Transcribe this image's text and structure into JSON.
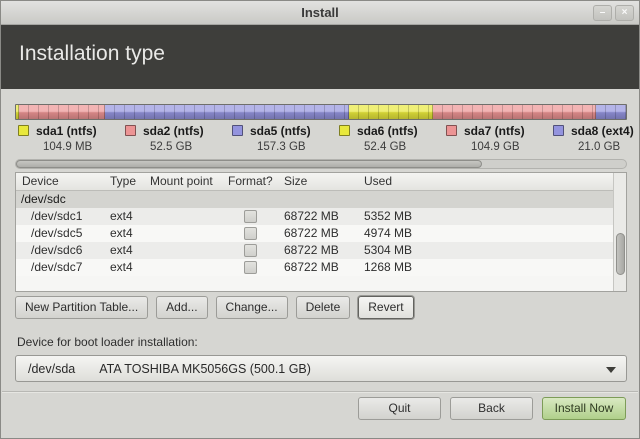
{
  "titlebar": {
    "title": "Install",
    "minimize_glyph": "–",
    "close_glyph": "×"
  },
  "header": {
    "title": "Installation type"
  },
  "partitions": [
    {
      "label": "sda1 (ntfs)",
      "size": "104.9 MB",
      "chip_color": "#e8e83c",
      "bar_flex": 0.25
    },
    {
      "label": "sda2 (ntfs)",
      "size": "52.5 GB",
      "chip_color": "#ec9494",
      "bar_flex": 14.1
    },
    {
      "label": "sda5 (ntfs)",
      "size": "157.3 GB",
      "chip_color": "#9494de",
      "bar_flex": 40.2
    },
    {
      "label": "sda6 (ntfs)",
      "size": "52.4 GB",
      "chip_color": "#e8e83c",
      "bar_flex": 13.7
    },
    {
      "label": "sda7 (ntfs)",
      "size": "104.9 GB",
      "chip_color": "#ec9494",
      "bar_flex": 26.8
    },
    {
      "label": "sda8 (ext4)",
      "size": "21.0 GB",
      "chip_color": "#9494de",
      "bar_flex": 4.95
    }
  ],
  "table": {
    "headers": [
      {
        "id": "device",
        "label": "Device"
      },
      {
        "id": "type",
        "label": "Type"
      },
      {
        "id": "mount-point",
        "label": "Mount point"
      },
      {
        "id": "format",
        "label": "Format?"
      },
      {
        "id": "size",
        "label": "Size"
      },
      {
        "id": "used",
        "label": "Used"
      }
    ],
    "group_row": "/dev/sdc",
    "rows": [
      {
        "device": "/dev/sdc1",
        "type": "ext4",
        "mount": "",
        "format_checked": false,
        "size": "68722 MB",
        "used": "5352 MB"
      },
      {
        "device": "/dev/sdc5",
        "type": "ext4",
        "mount": "",
        "format_checked": false,
        "size": "68722 MB",
        "used": "4974 MB"
      },
      {
        "device": "/dev/sdc6",
        "type": "ext4",
        "mount": "",
        "format_checked": false,
        "size": "68722 MB",
        "used": "5304 MB"
      },
      {
        "device": "/dev/sdc7",
        "type": "ext4",
        "mount": "",
        "format_checked": false,
        "size": "68722 MB",
        "used": "1268 MB"
      }
    ]
  },
  "partition_actions": [
    {
      "id": "new-partition-table",
      "label": "New Partition Table...",
      "focused": false
    },
    {
      "id": "add",
      "label": "Add...",
      "focused": false
    },
    {
      "id": "change",
      "label": "Change...",
      "focused": false
    },
    {
      "id": "delete",
      "label": "Delete",
      "focused": false
    },
    {
      "id": "revert",
      "label": "Revert",
      "focused": true
    }
  ],
  "bootloader": {
    "label": "Device for boot loader installation:",
    "device": "/dev/sda",
    "description": "ATA TOSHIBA MK5056GS (500.1 GB)"
  },
  "footer": {
    "quit": "Quit",
    "back": "Back",
    "install": "Install Now"
  },
  "colors": {
    "header_band": "#3e3e3b",
    "window_bg": "#d6d6d2",
    "install_button_green": "#b0d08b",
    "segment_yellow": "#e8e83c",
    "segment_red": "#ec9494",
    "segment_blue": "#9494de"
  }
}
